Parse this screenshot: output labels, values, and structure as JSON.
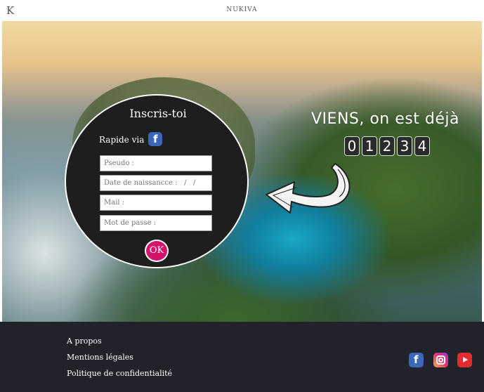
{
  "header": {
    "logo_letter": "K",
    "brand": "NUKIVA"
  },
  "signup": {
    "title": "Inscris-toi",
    "rapide_label": "Rapide via",
    "facebook_icon": "facebook-icon",
    "fields": {
      "pseudo": "Pseudo :",
      "birthdate": "Date de naissancce :   /   /",
      "mail": "Mail :",
      "password": "Mot de passe :"
    },
    "ok_label": "OK",
    "ok_color": "#d4136b"
  },
  "hero": {
    "headline": "VIENS, on est déjà",
    "counter_digits": [
      "0",
      "1",
      "2",
      "3",
      "4"
    ]
  },
  "footer": {
    "links": [
      "A propos",
      "Mentions légales",
      "Politique de confidentialité"
    ],
    "social_icons": [
      "facebook-icon",
      "instagram-icon",
      "youtube-icon"
    ],
    "background": "#22232a"
  }
}
